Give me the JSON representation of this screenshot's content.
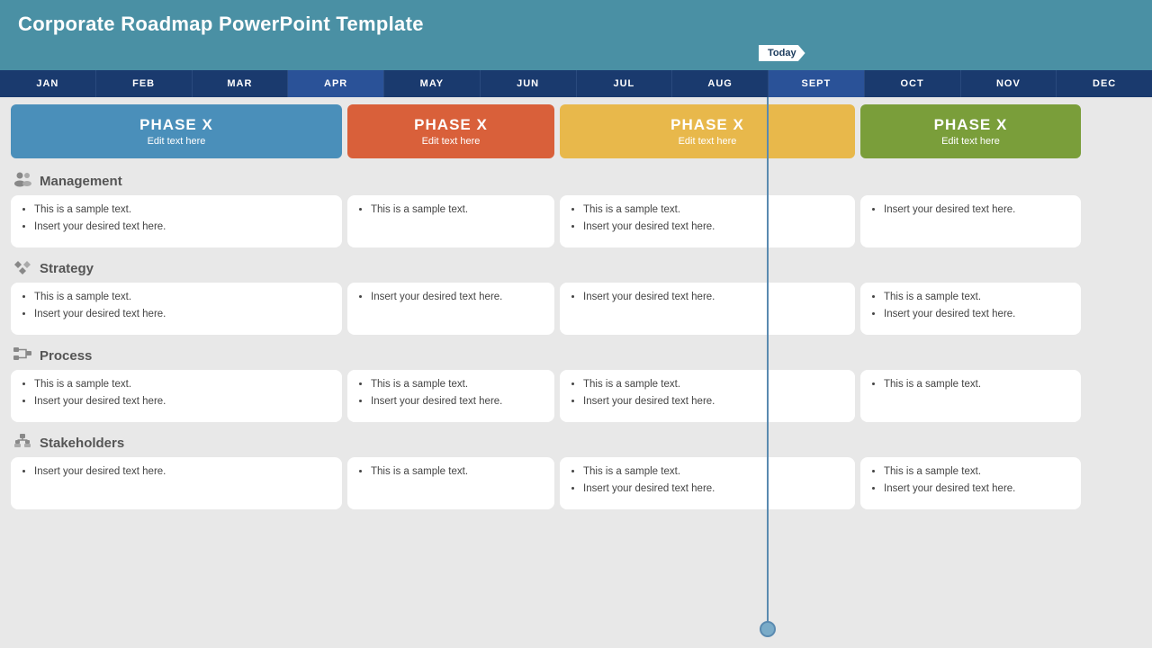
{
  "title": "Corporate Roadmap PowerPoint Template",
  "today_label": "Today",
  "months": [
    "JAN",
    "FEB",
    "MAR",
    "APR",
    "MAY",
    "JUN",
    "JUL",
    "AUG",
    "SEPT",
    "OCT",
    "NOV",
    "DEC"
  ],
  "phases": [
    {
      "id": 1,
      "title": "PHASE X",
      "subtitle": "Edit text here",
      "color": "#4a8fba"
    },
    {
      "id": 2,
      "title": "PHASE X",
      "subtitle": "Edit text here",
      "color": "#d9603a"
    },
    {
      "id": 3,
      "title": "PHASE X",
      "subtitle": "Edit text here",
      "color": "#e8b84b"
    },
    {
      "id": 4,
      "title": "PHASE X",
      "subtitle": "Edit text here",
      "color": "#7a9e3a"
    }
  ],
  "sections": [
    {
      "id": "management",
      "label": "Management",
      "icon": "👥",
      "cards": [
        {
          "items": [
            "This is a sample text.",
            "Insert your desired text here."
          ]
        },
        {
          "items": [
            "This is a sample text."
          ]
        },
        {
          "items": [
            "This is a sample text.",
            "Insert your desired text here."
          ]
        },
        {
          "items": [
            "Insert your desired text here."
          ]
        }
      ]
    },
    {
      "id": "strategy",
      "label": "Strategy",
      "icon": "⚙",
      "cards": [
        {
          "items": [
            "This is a sample text.",
            "Insert your desired text here."
          ]
        },
        {
          "items": [
            "Insert your desired text here."
          ]
        },
        {
          "items": [
            "Insert your desired text here."
          ]
        },
        {
          "items": [
            "This is a sample text.",
            "Insert your desired text here."
          ]
        }
      ]
    },
    {
      "id": "process",
      "label": "Process",
      "icon": "🔗",
      "cards": [
        {
          "items": [
            "This is a sample text.",
            "Insert your desired text here."
          ]
        },
        {
          "items": [
            "This is a sample text.",
            "Insert your desired text here."
          ]
        },
        {
          "items": [
            "This is a sample text.",
            "Insert your desired text here."
          ]
        },
        {
          "items": [
            "This is a sample text."
          ]
        }
      ]
    },
    {
      "id": "stakeholders",
      "label": "Stakeholders",
      "icon": "🏢",
      "cards": [
        {
          "items": [
            "Insert your desired text here."
          ]
        },
        {
          "items": [
            "This is a sample text."
          ]
        },
        {
          "items": [
            "This is a sample text.",
            "Insert your desired text here."
          ]
        },
        {
          "items": [
            "This is a sample text.",
            "Insert your desired text here."
          ]
        }
      ]
    }
  ]
}
